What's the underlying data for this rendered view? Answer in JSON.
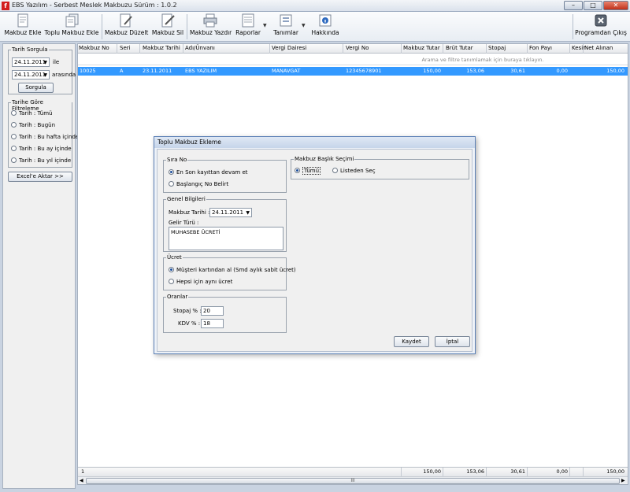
{
  "window": {
    "title": "EBS Yazılım - Serbest Meslek Makbuzu Sürüm : 1.0.2"
  },
  "toolbar": {
    "makbuz_ekle": "Makbuz Ekle",
    "toplu_makbuz_ekle": "Toplu Makbuz Ekle",
    "makbuz_duzelt": "Makbuz Düzelt",
    "makbuz_sil": "Makbuz Sil",
    "makbuz_yazdir": "Makbuz Yazdır",
    "raporlar": "Raporlar",
    "tanimlar": "Tanımlar",
    "hakkinda": "Hakkında",
    "programdan_cikis": "Programdan Çıkış"
  },
  "left": {
    "tarih_sorgula_title": "Tarih Sorgula",
    "date_from": "24.11.2011",
    "date_from_suffix": "ile",
    "date_to": "24.11.2011",
    "date_to_suffix": "arasında",
    "sorgula": "Sorgula",
    "filter_title": "Tarihe Göre Filtreleme",
    "filters": [
      "Tarih : Tümü",
      "Tarih : Bugün",
      "Tarih : Bu hafta içinde",
      "Tarih : Bu ay içinde",
      "Tarih : Bu yıl içinde"
    ],
    "excel": "Excel'e Aktar >>"
  },
  "grid": {
    "headers": [
      "Makbuz No",
      "Seri",
      "Makbuz Tarihi",
      "Adı/Ünvanı",
      "Vergi Dairesi",
      "Vergi No",
      "Makbuz Tutar",
      "Brüt Tutar",
      "Stopaj",
      "Fon Payı",
      "Kesir",
      "Net Alınan"
    ],
    "filter_hint": "Arama ve filtre tanımlamak için buraya tıklayın.",
    "row": [
      "10025",
      "A",
      "23.11.2011",
      "EBS YAZILIM",
      "MANAVGAT",
      "12345678901",
      "150,00",
      "153,06",
      "30,61",
      "0,00",
      "",
      "150,00"
    ],
    "footer": {
      "count": "1",
      "makbuz_tutar": "150,00",
      "brut_tutar": "153,06",
      "stopaj": "30,61",
      "fon_payi": "0,00",
      "net_alinan": "150,00"
    },
    "scroll_grip": "III"
  },
  "dialog": {
    "title": "Toplu Makbuz Ekleme",
    "sira_no_title": "Sıra No",
    "sira_opt1": "En Son kayıttan devam et",
    "sira_opt2": "Başlangıç No Belirt",
    "genel_title": "Genel Bilgileri",
    "makbuz_tarihi_label": "Makbuz Tarihi :",
    "makbuz_tarihi": "24.11.2011",
    "gelir_turu_label": "Gelir Türü :",
    "gelir_turu": "MUHASEBE ÜCRETİ",
    "ucret_title": "Ücret",
    "ucret_opt1": "Müşteri kartından al (Smd aylık sabit ücret)",
    "ucret_opt2": "Hepsi için aynı ücret",
    "oranlar_title": "Oranlar",
    "stopaj_label": "Stopaj % :",
    "stopaj": "20",
    "kdv_label": "KDV % :",
    "kdv": "18",
    "baslik_title": "Makbuz Başlık Seçimi",
    "baslik_opt1": "Tümü",
    "baslik_opt2": "Listeden Seç",
    "kaydet": "Kaydet",
    "iptal": "İptal"
  }
}
